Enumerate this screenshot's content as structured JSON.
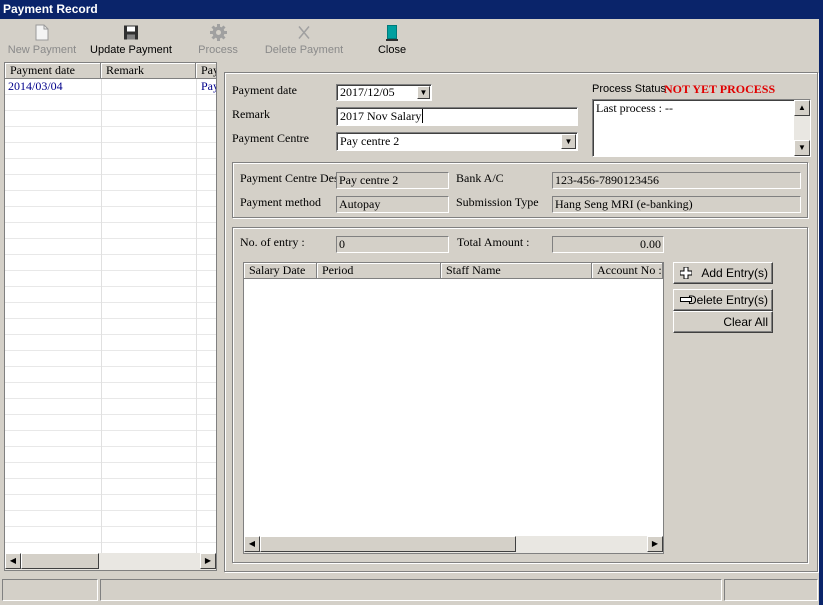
{
  "window": {
    "title": "Payment Record"
  },
  "toolbar": {
    "new_payment": "New Payment",
    "update_payment": "Update Payment",
    "process": "Process",
    "delete_payment": "Delete Payment",
    "close": "Close"
  },
  "list": {
    "columns": [
      "Payment date",
      "Remark",
      "Pay"
    ],
    "rows": [
      {
        "date": "2014/03/04",
        "remark": "",
        "pay": "Pay"
      }
    ]
  },
  "form": {
    "payment_date_label": "Payment date",
    "payment_date_value": "2017/12/05",
    "remark_label": "Remark",
    "remark_value": "2017 Nov Salary",
    "payment_centre_label": "Payment Centre",
    "payment_centre_value": "Pay centre 2",
    "process_status_label": "Process Status",
    "process_status_value": "NOT YET PROCESS",
    "last_process_text": "Last process : --"
  },
  "centre_info": {
    "desc_label": "Payment Centre Desc",
    "desc_value": "Pay centre 2",
    "bank_label": "Bank A/C",
    "bank_value": "123-456-7890123456",
    "method_label": "Payment method",
    "method_value": "Autopay",
    "submission_label": "Submission Type",
    "submission_value": "Hang Seng MRI (e-banking)"
  },
  "entries": {
    "count_label": "No. of entry :",
    "count_value": "0",
    "total_label": "Total Amount :",
    "total_value": "0.00",
    "columns": [
      "Salary Date",
      "Period",
      "Staff Name",
      "Account No :"
    ],
    "add_button": "Add Entry(s)",
    "delete_button": "Delete Entry(s)",
    "clear_button": "Clear All"
  },
  "colors": {
    "titlebar": "#0a246a",
    "status_red": "#e00000",
    "list_text": "#00008b"
  },
  "icons": [
    "document-icon",
    "floppy-disk-icon",
    "gear-icon",
    "x-icon",
    "close-door-icon",
    "plus-icon",
    "minus-icon"
  ]
}
